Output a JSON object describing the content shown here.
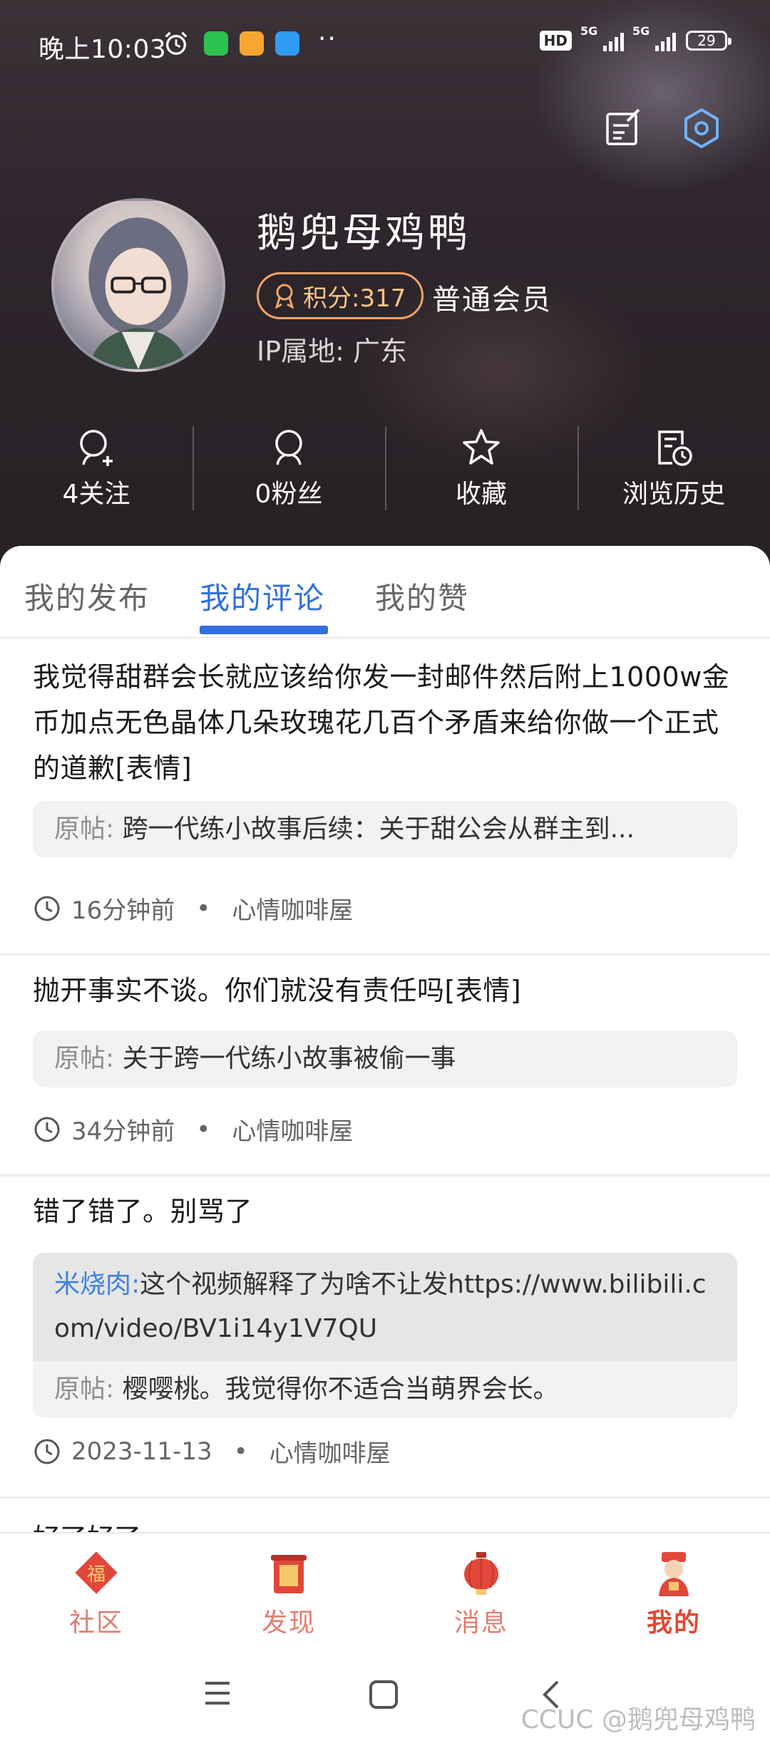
{
  "status_bar": {
    "time": "晚上10:03",
    "more": "··",
    "hd": "HD",
    "net1": "5G",
    "net2": "5G",
    "battery": "29"
  },
  "profile": {
    "username": "鹅兜母鸡鸭",
    "points": "积分:317",
    "member_level": "普通会员",
    "ip_location": "IP属地: 广东"
  },
  "stats": [
    {
      "label": "4关注",
      "icon": "follow-icon"
    },
    {
      "label": "0粉丝",
      "icon": "fans-icon"
    },
    {
      "label": "收藏",
      "icon": "star-icon"
    },
    {
      "label": "浏览历史",
      "icon": "history-icon"
    }
  ],
  "tabs": [
    "我的发布",
    "我的评论",
    "我的赞"
  ],
  "active_tab": "我的评论",
  "comments": [
    {
      "text": "我觉得甜群会长就应该给你发一封邮件然后附上1000w金币加点无色晶体几朵玫瑰花几百个矛盾来给你做一个正式的道歉[表情]",
      "origin_key": "原帖:",
      "origin": "跨一代练小故事后续：关于甜公会从群主到...",
      "time": "16分钟前",
      "board": "心情咖啡屋"
    },
    {
      "text": "抛开事实不谈。你们就没有责任吗[表情]",
      "origin_key": "原帖:",
      "origin": "关于跨一代练小故事被偷一事",
      "time": "34分钟前",
      "board": "心情咖啡屋"
    },
    {
      "text": "错了错了。别骂了",
      "reply_key": "米烧肉:",
      "reply": "这个视频解释了为啥不让发https://www.bilibili.com/video/BV1i14y1V7QU",
      "origin_key": "原帖:",
      "origin": "樱嘤桃。我觉得你不适合当萌界会长。",
      "time": "2023-11-13",
      "board": "心情咖啡屋"
    }
  ],
  "partial_next": "好了好了",
  "bottom_nav": [
    {
      "label": "社区",
      "icon": "fu-icon"
    },
    {
      "label": "发现",
      "icon": "dragon-scroll-icon"
    },
    {
      "label": "消息",
      "icon": "lantern-icon"
    },
    {
      "label": "我的",
      "icon": "caishen-icon"
    }
  ],
  "watermark": "CCUC @鹅兜母鸡鸭",
  "colors": {
    "accent_blue": "#2f6fde",
    "points_orange": "#f0a46a",
    "nav_red": "#e04a31"
  }
}
